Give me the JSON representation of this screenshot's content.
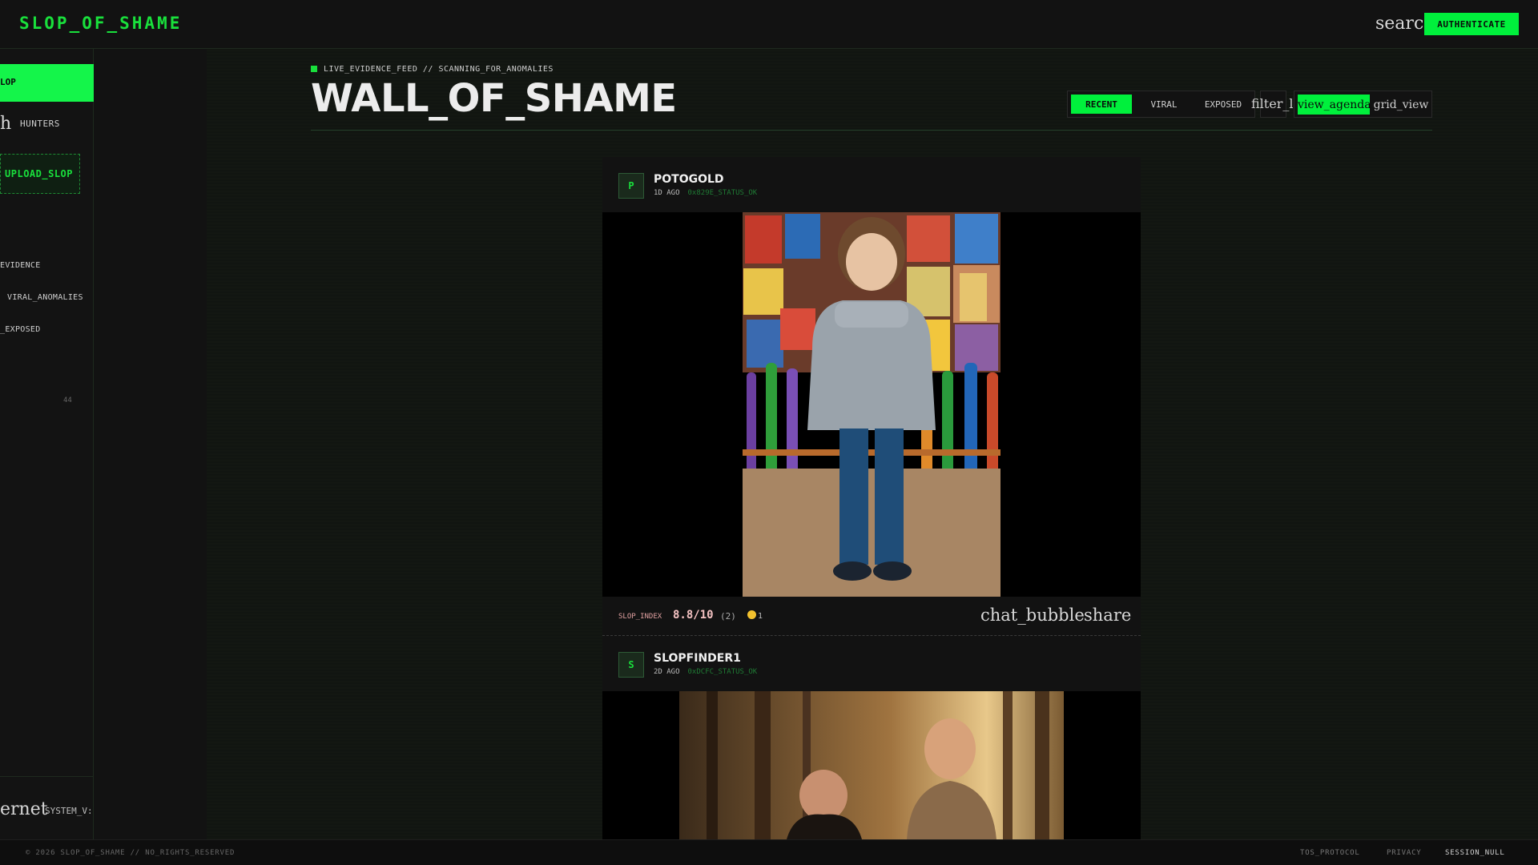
{
  "header": {
    "logo": "SLOP_OF_SHAME",
    "search_icon_text": "search",
    "auth_label": "AUTHENTICATE"
  },
  "sidebar": {
    "active_item": "LOP",
    "hunters_glyph": "h",
    "hunters_label": "HUNTERS",
    "upload_label": "UPLOAD_SLOP",
    "links": [
      "EVIDENCE",
      "VIRAL_ANOMALIES",
      "_EXPOSED"
    ],
    "count": "44",
    "bottom_glyph": "ernet",
    "bottom_label": "SYSTEM_V:"
  },
  "main": {
    "feed_tag": "LIVE_EVIDENCE_FEED // SCANNING_FOR_ANOMALIES",
    "title": "WALL_OF_SHAME",
    "sort_tabs": [
      "RECENT",
      "VIRAL",
      "EXPOSED"
    ],
    "active_sort": "RECENT",
    "filter_icon_text": "filter_list",
    "view_agenda_text": "view_agenda",
    "grid_view_text": "grid_view"
  },
  "posts": [
    {
      "avatar": "P",
      "username": "POTOGOLD",
      "age": "1D AGO",
      "hash": "0x829E_STATUS_OK",
      "slop_label": "SLOP_INDEX",
      "slop_value": "8.8/10",
      "slop_count": "(2)",
      "coins": "1",
      "comment_icon_text": "chat_bubble",
      "share_icon_text": "share"
    },
    {
      "avatar": "S",
      "username": "SLOPFINDER1",
      "age": "2D AGO",
      "hash": "0xDCFC_STATUS_OK"
    }
  ],
  "footer": {
    "copyright": "© 2026 SLOP_OF_SHAME // NO_RIGHTS_RESERVED",
    "links": [
      "TOS_PROTOCOL",
      "PRIVACY",
      "SESSION_NULL"
    ]
  },
  "colors": {
    "accent": "#00f03c",
    "background": "#121212",
    "slop_value": "#f4c2c2"
  }
}
